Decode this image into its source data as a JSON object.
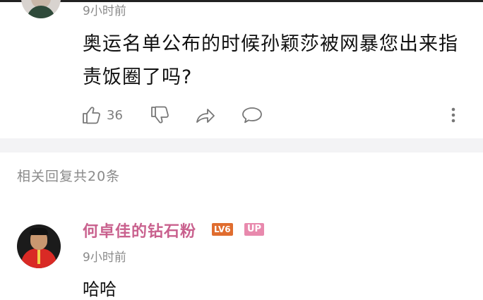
{
  "top_comment": {
    "time": "9小时前",
    "text": "奥运名单公布的时候孙颖莎被网暴您出来指责饭圈了吗?",
    "like_count": "36"
  },
  "related": {
    "label": "相关回复共20条"
  },
  "reply": {
    "username": "何卓佳的钻石粉",
    "level_badge": "LV6",
    "up_badge": "UP",
    "time": "9小时前",
    "text_partial": "哈哈"
  },
  "colors": {
    "username": "#c9618e",
    "level_badge": "#e06d2f",
    "up_badge": "#e889ad",
    "meta_text": "#8a8a8a"
  },
  "icons": [
    "like-icon",
    "dislike-icon",
    "share-icon",
    "comment-icon",
    "more-icon"
  ]
}
